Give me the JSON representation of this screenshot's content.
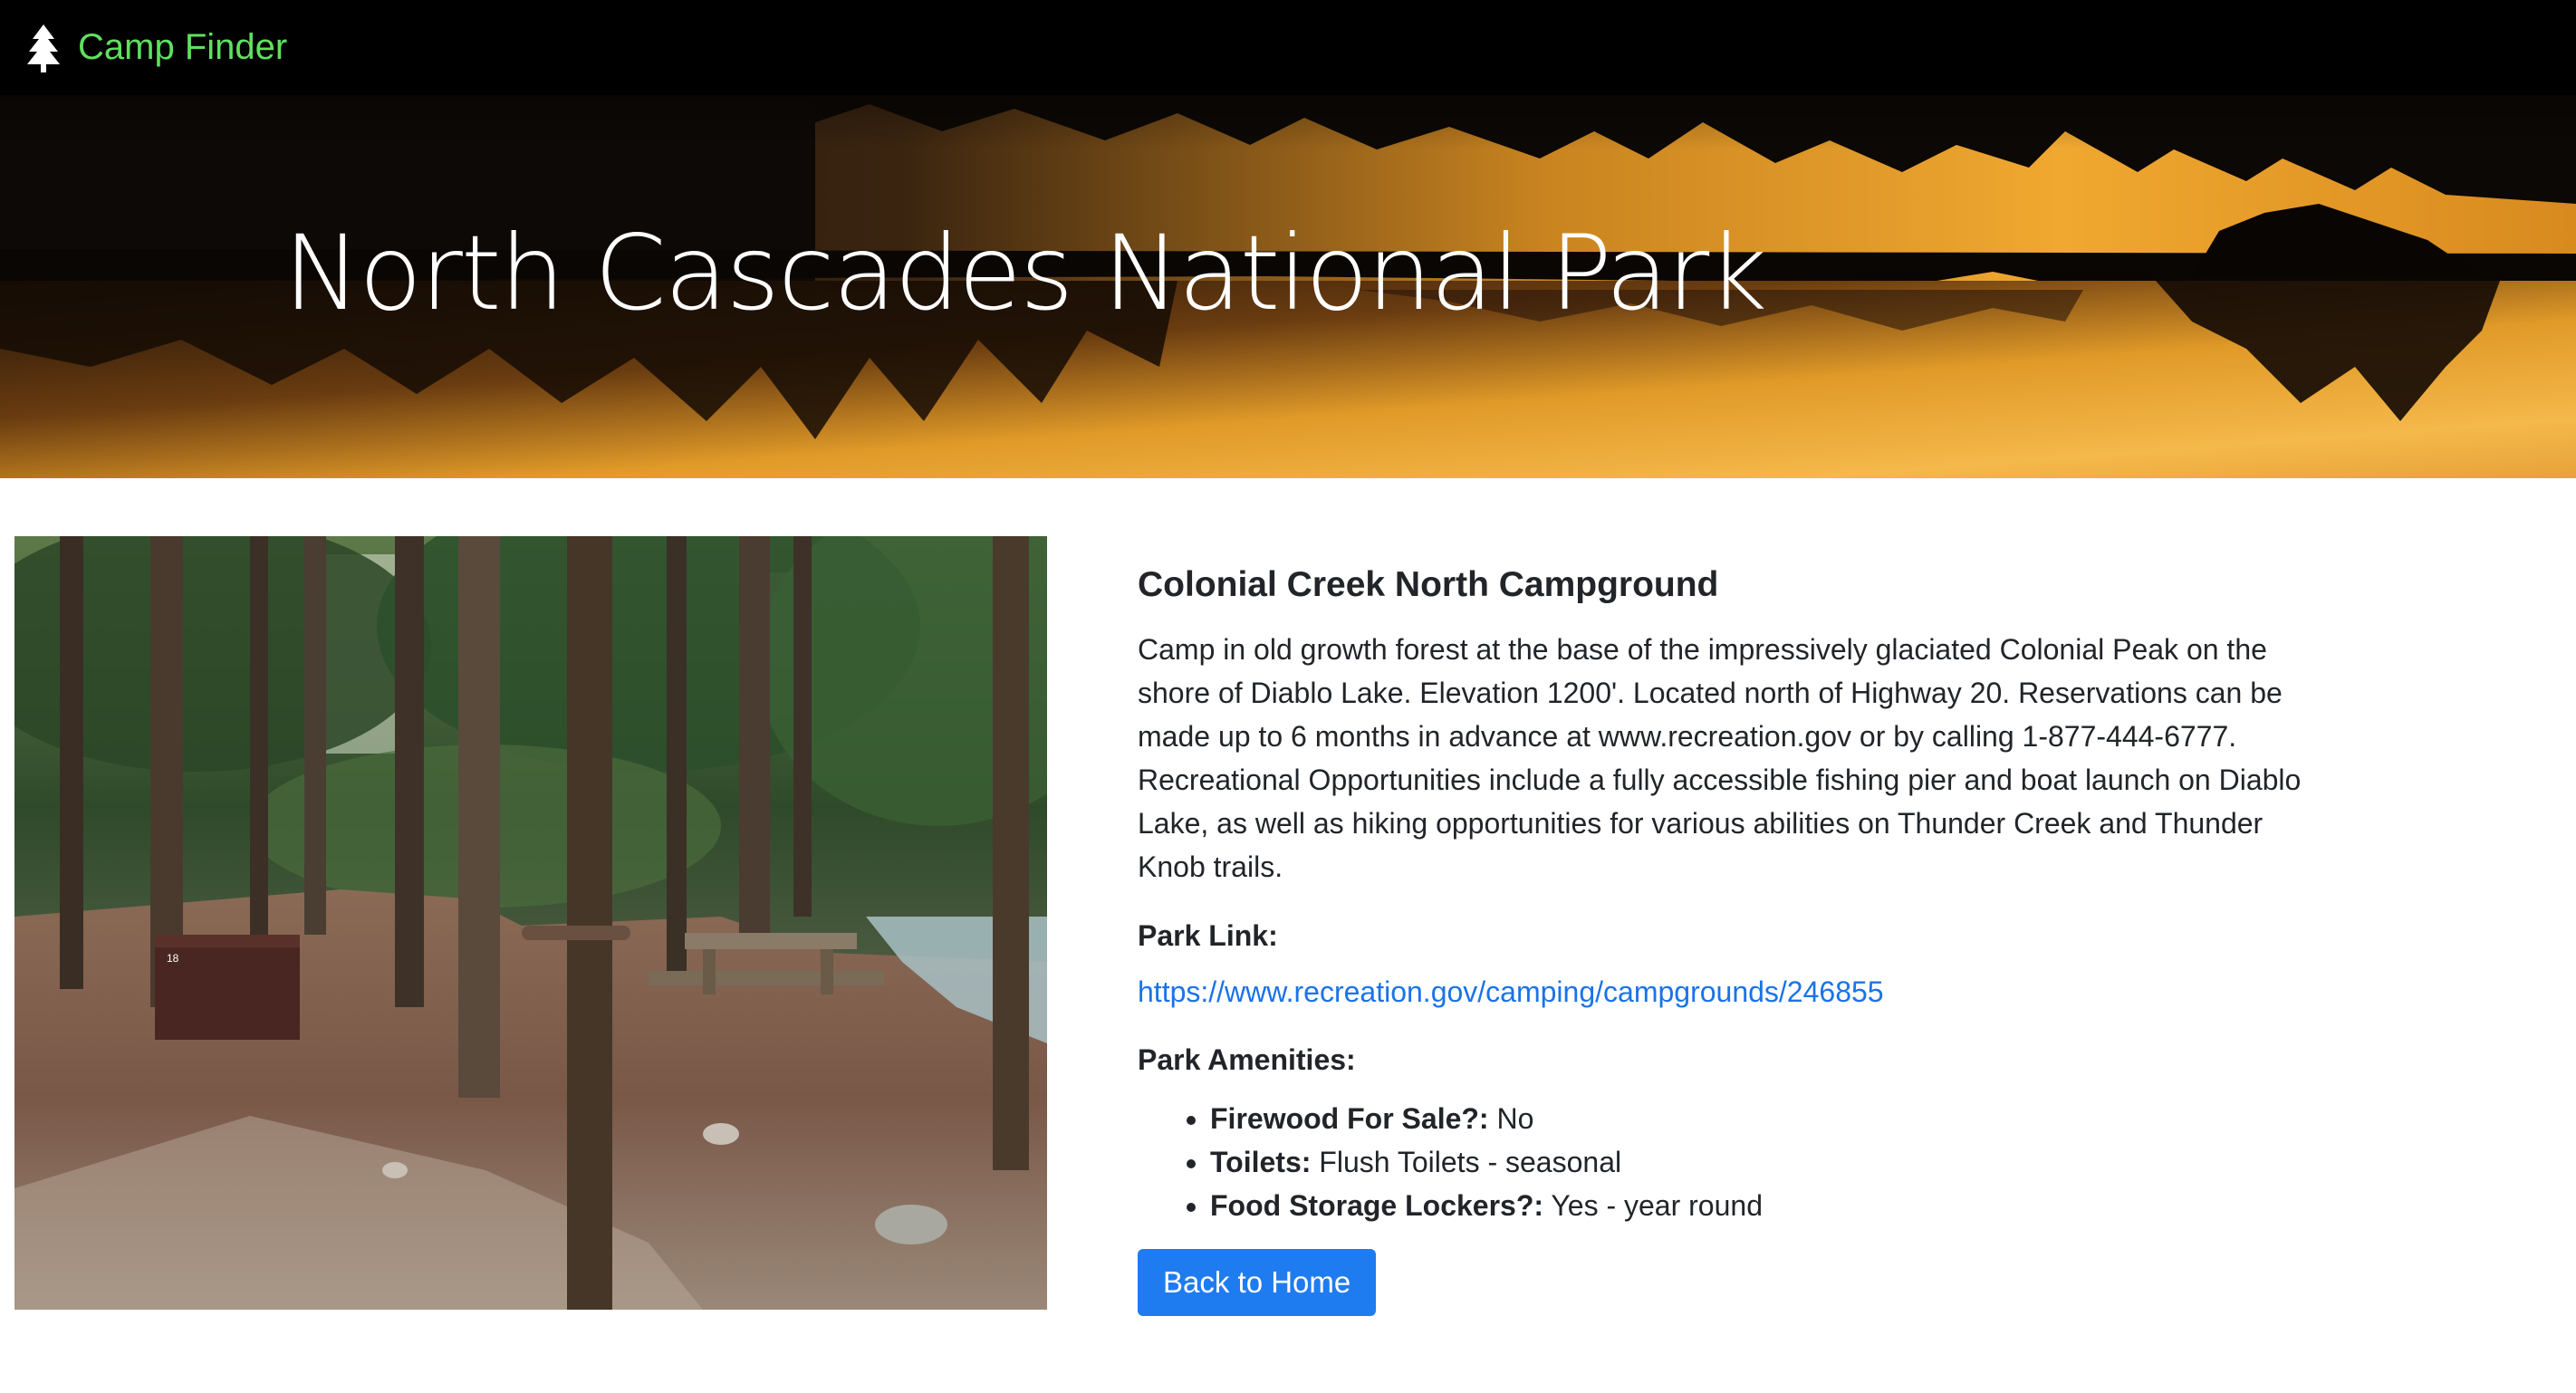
{
  "nav": {
    "brand": "Camp Finder",
    "brand_icon": "tree-icon",
    "brand_color": "#5fe15f"
  },
  "hero": {
    "title": "North Cascades National Park"
  },
  "campground": {
    "name": "Colonial Creek North Campground",
    "description": "Camp in old growth forest at the base of the impressively glaciated Colonial Peak on the shore of Diablo Lake. Elevation 1200'. Located north of Highway 20. Reservations can be made up to 6 months in advance at www.recreation.gov or by calling 1-877-444-6777. Recreational Opportunities include a fully accessible fishing pier and boat launch on Diablo Lake, as well as hiking opportunities for various abilities on Thunder Creek and Thunder Knob trails.",
    "park_link_label": "Park Link:",
    "park_link_url": "https://www.recreation.gov/camping/campgrounds/246855",
    "amenities_label": "Park Amenities:",
    "amenities": [
      {
        "name": "Firewood For Sale?:",
        "value": "No"
      },
      {
        "name": "Toilets:",
        "value": "Flush Toilets - seasonal"
      },
      {
        "name": "Food Storage Lockers?:",
        "value": "Yes - year round"
      }
    ],
    "site_number": "18"
  },
  "actions": {
    "back_label": "Back to Home"
  },
  "colors": {
    "navbar": "#000000",
    "button": "#1f7cf0",
    "link": "#1a73e8"
  }
}
